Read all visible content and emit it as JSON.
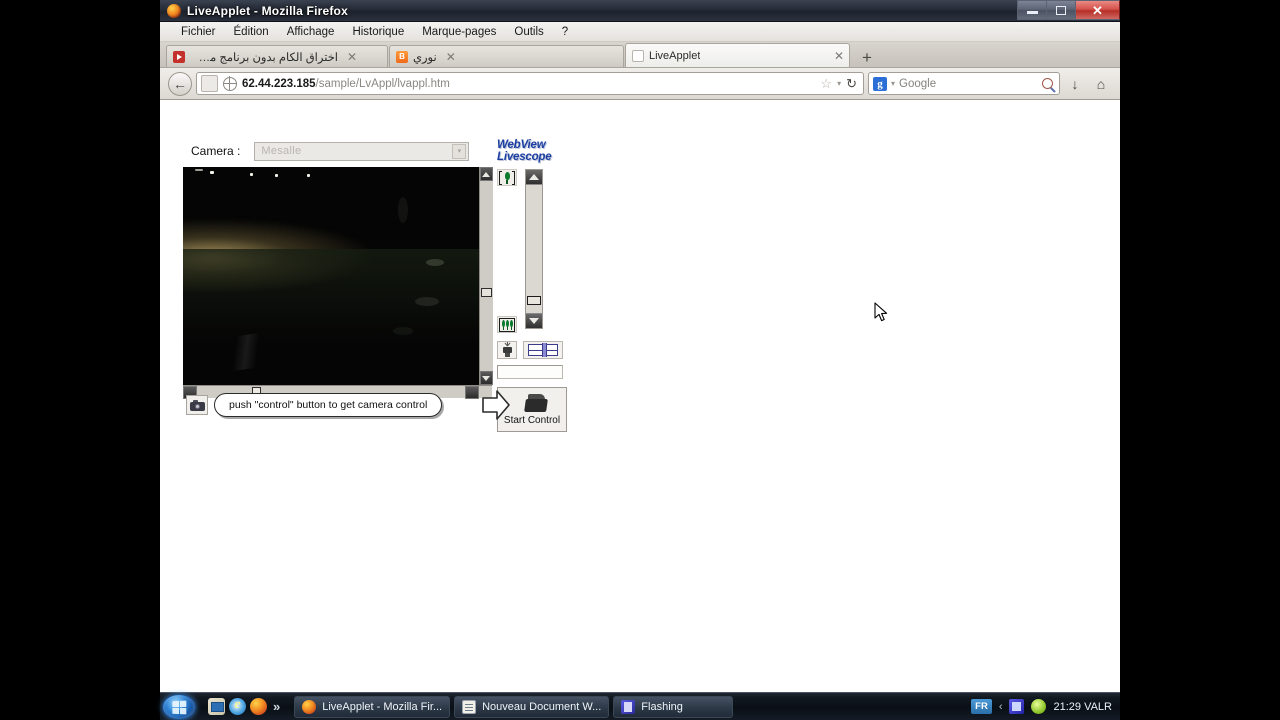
{
  "window": {
    "title": "LiveApplet - Mozilla Firefox",
    "minimize_label": "Minimize",
    "maximize_label": "Restore",
    "close_label": "✕"
  },
  "menu": [
    {
      "label": "Fichier"
    },
    {
      "label": "Édition"
    },
    {
      "label": "Affichage"
    },
    {
      "label": "Historique"
    },
    {
      "label": "Marque-pages"
    },
    {
      "label": "Outils"
    },
    {
      "label": "?"
    }
  ],
  "tabs": [
    {
      "label": "اختراق الكام بدون برنامج من اساسه الى...",
      "icon": "youtube-icon",
      "active": false,
      "close": "✕"
    },
    {
      "label": "نوري",
      "icon": "blogger-icon",
      "active": false,
      "close": "✕"
    },
    {
      "label": "LiveApplet",
      "icon": "blank-page-icon",
      "active": true,
      "close": "✕"
    }
  ],
  "new_tab_label": "+",
  "toolbar": {
    "back_glyph": "←",
    "url_host": "62.44.223.185",
    "url_path": "/sample/LvAppl/lvappl.htm",
    "url_full": "62.44.223.185/sample/LvAppl/lvappl.htm",
    "star_glyph": "☆",
    "dropdown_glyph": "▾",
    "reload_glyph": "↻",
    "search_engine": "Google",
    "search_placeholder": "Google",
    "download_glyph": "↓",
    "home_glyph": "⌂"
  },
  "applet": {
    "camera_label": "Camera :",
    "camera_value": "Mesalle",
    "camera_arrow": "▾",
    "logo_line1": "WebView",
    "logo_line2": "Livescope",
    "zoom_tele_name": "telephoto-zoom-button",
    "zoom_wide_name": "wide-angle-zoom-button",
    "start_control_label": "Start Control",
    "callout_text": "push \"control\" button to get camera control",
    "scroll": {
      "h_thumb_pct": 22,
      "v_thumb_pct": 55,
      "zoom_thumb_pct": 88
    }
  },
  "taskbar": {
    "start_label": "Start",
    "quick_launch": [
      {
        "name": "show-desktop-icon"
      },
      {
        "name": "internet-explorer-icon"
      },
      {
        "name": "firefox-icon"
      }
    ],
    "quick_more": "»",
    "tasks": [
      {
        "label": "LiveApplet - Mozilla Fir...",
        "icon": "firefox-icon",
        "active": true
      },
      {
        "label": "Nouveau Document W...",
        "icon": "document-icon",
        "active": false
      },
      {
        "label": "Flashing",
        "icon": "flashing-icon",
        "active": false
      }
    ],
    "tray": {
      "language": "FR",
      "chevron": "‹",
      "icons": [
        {
          "name": "network-icon"
        },
        {
          "name": "security-shield-icon"
        }
      ],
      "clock": "21:29 VALR"
    }
  },
  "colors": {
    "accent_blue": "#1b3fa0",
    "close_red": "#b62f28",
    "tree_green": "#0a7a2d",
    "taskbar_dark": "#0a0f16"
  }
}
